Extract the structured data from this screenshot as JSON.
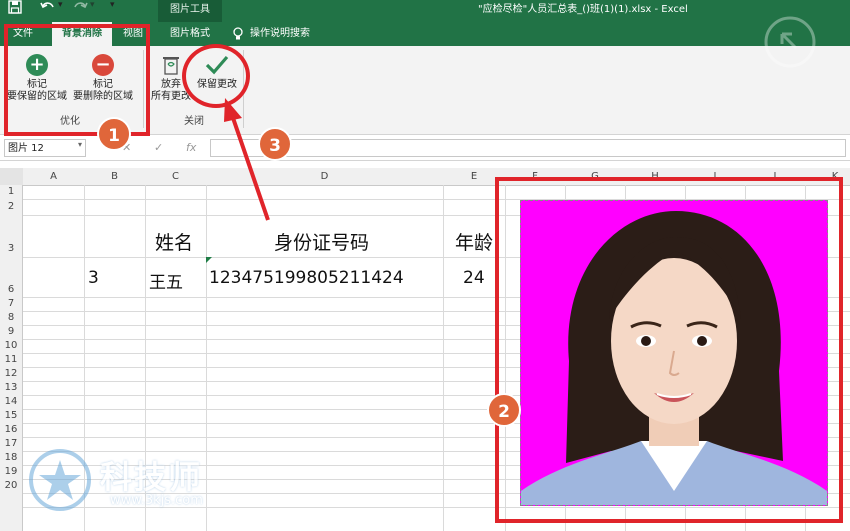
{
  "titlebar": {
    "save_icon": "save-icon",
    "undo_icon": "undo-icon",
    "redo_icon": "redo-icon",
    "context_tab": "图片工具",
    "document_title": "\"应检尽检\"人员汇总表_()班(1)(1).xlsx  -  Excel"
  },
  "tabs": {
    "file": "文件",
    "background_removal": "背景消除",
    "view": "视图",
    "picture_format": "图片格式",
    "tell_me": "操作说明搜索"
  },
  "ribbon": {
    "mark_keep_line1": "标记",
    "mark_keep_line2": "要保留的区域",
    "mark_delete_line1": "标记",
    "mark_delete_line2": "要删除的区域",
    "group_refine": "优化",
    "discard_line1": "放弃",
    "discard_line2": "所有更改",
    "keep_changes": "保留更改",
    "group_close": "关闭"
  },
  "formula_bar": {
    "name_box": "图片 12",
    "fx": "fx"
  },
  "columns": [
    "A",
    "B",
    "C",
    "D",
    "E",
    "F",
    "G",
    "H",
    "I",
    "J",
    "K"
  ],
  "rows": [
    "1",
    "2",
    "3",
    "6",
    "7",
    "8",
    "9",
    "10",
    "11",
    "12",
    "13",
    "14",
    "15",
    "16",
    "17",
    "18",
    "19",
    "20"
  ],
  "sheet": {
    "header_name": "姓名",
    "header_id": "身份证号码",
    "header_age": "年龄",
    "row_num": "3",
    "row_name": "王五",
    "row_id": "123475199805211424",
    "row_age": "24"
  },
  "annotations": [
    "1",
    "2",
    "3"
  ],
  "watermark": {
    "name": "科技师",
    "url": "www.3kjs.com"
  },
  "colors": {
    "excel_green": "#217346",
    "annotation_red": "#e0242a",
    "badge_orange": "#e0663a",
    "photo_background": "#ff00ff"
  }
}
